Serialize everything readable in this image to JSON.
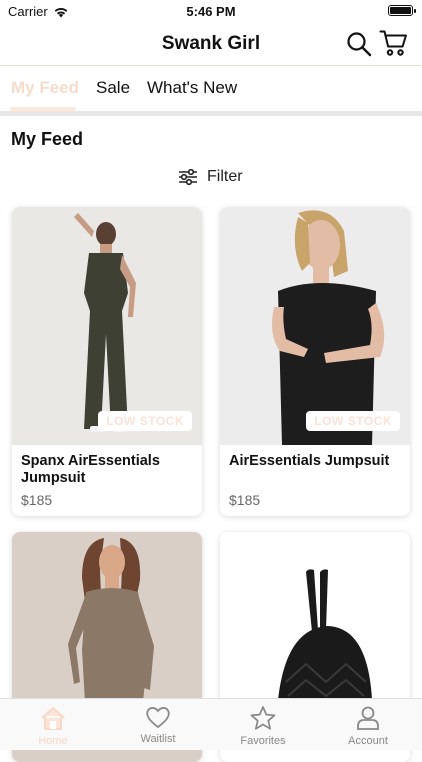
{
  "status": {
    "carrier": "Carrier",
    "time": "5:46 PM"
  },
  "navbar": {
    "title": "Swank Girl",
    "search_icon": "search-icon",
    "cart_icon": "cart-icon"
  },
  "tabs": [
    {
      "label": "My Feed",
      "active": true
    },
    {
      "label": "Sale",
      "active": false
    },
    {
      "label": "What's New",
      "active": false
    }
  ],
  "section": {
    "title": "My Feed"
  },
  "filter": {
    "label": "Filter",
    "icon": "sliders-icon"
  },
  "products": [
    {
      "name": "Spanx AirEssentials Jumpsuit",
      "price": "$185",
      "badge": "LOW STOCK"
    },
    {
      "name": "AirEssentials Jumpsuit",
      "price": "$185",
      "badge": "LOW STOCK"
    },
    {
      "name": "",
      "price": "",
      "badge": ""
    },
    {
      "name": "",
      "price": "",
      "badge": ""
    }
  ],
  "bottom_nav": [
    {
      "label": "Home",
      "icon": "home-icon",
      "active": true
    },
    {
      "label": "Waitlist",
      "icon": "heart-icon",
      "active": false
    },
    {
      "label": "Favorites",
      "icon": "star-icon",
      "active": false
    },
    {
      "label": "Account",
      "icon": "person-icon",
      "active": false
    }
  ],
  "colors": {
    "accent": "#f6dccb",
    "divider": "#e7e7e7"
  }
}
